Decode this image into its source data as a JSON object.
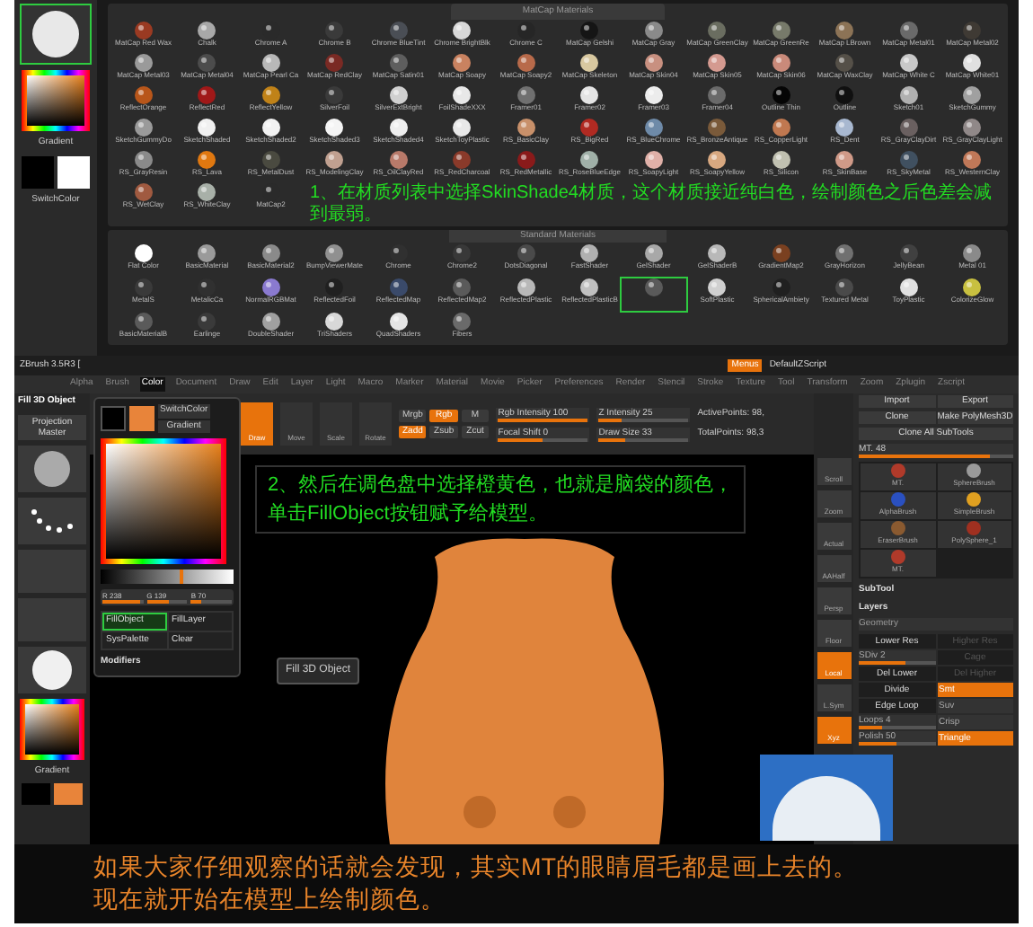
{
  "left_column": {
    "gradient_label": "Gradient",
    "switch_label": "SwitchColor"
  },
  "matcap_panel": {
    "title": "MatCap Materials",
    "materials": [
      {
        "name": "MatCap Red Wax",
        "color": "#9a3a22",
        "selected": false
      },
      {
        "name": "Chalk",
        "color": "#a8a8a8",
        "selected": false
      },
      {
        "name": "Chrome A",
        "color": "#2a2a2a",
        "selected": false
      },
      {
        "name": "Chrome B",
        "color": "#3a3a3a",
        "selected": false
      },
      {
        "name": "Chrome BlueTint",
        "color": "#4a4e55",
        "selected": false
      },
      {
        "name": "Chrome BrightBlk",
        "color": "#d8d8d8",
        "selected": false
      },
      {
        "name": "Chrome C",
        "color": "#262626",
        "selected": false
      },
      {
        "name": "MatCap Gelshi",
        "color": "#151515",
        "selected": false
      },
      {
        "name": "MatCap Gray",
        "color": "#8a8a8a",
        "selected": false
      },
      {
        "name": "MatCap GreenClay",
        "color": "#6a6d60",
        "selected": false
      },
      {
        "name": "MatCap GreenRe",
        "color": "#777a6a",
        "selected": false
      },
      {
        "name": "MatCap LBrown",
        "color": "#8c7356",
        "selected": false
      },
      {
        "name": "MatCap Metal01",
        "color": "#6a6a6a",
        "selected": false
      },
      {
        "name": "MatCap Metal02",
        "color": "#3f3a34",
        "selected": false
      },
      {
        "name": "MatCap Metal03",
        "color": "#9a9a9a",
        "selected": false
      },
      {
        "name": "MatCap Metal04",
        "color": "#4c4c4c",
        "selected": false
      },
      {
        "name": "MatCap Pearl Ca",
        "color": "#b8b8b8",
        "selected": false
      },
      {
        "name": "MatCap RedClay",
        "color": "#7a2a24",
        "selected": false
      },
      {
        "name": "MatCap Satin01",
        "color": "#5e5e5e",
        "selected": false
      },
      {
        "name": "MatCap Soapy",
        "color": "#c98260",
        "selected": false
      },
      {
        "name": "MatCap Soapy2",
        "color": "#b86a4a",
        "selected": false
      },
      {
        "name": "MatCap Skeleton",
        "color": "#d8c8a0",
        "selected": false
      },
      {
        "name": "MatCap Skin04",
        "color": "#c89080",
        "selected": false
      },
      {
        "name": "MatCap Skin05",
        "color": "#d49a90",
        "selected": false
      },
      {
        "name": "MatCap Skin06",
        "color": "#c98a7a",
        "selected": false
      },
      {
        "name": "MatCap WaxClay",
        "color": "#555048",
        "selected": false
      },
      {
        "name": "MatCap White C",
        "color": "#c8c8c8",
        "selected": false
      },
      {
        "name": "MatCap White01",
        "color": "#e0e0e0",
        "selected": false
      },
      {
        "name": "ReflectOrange",
        "color": "#b8561a",
        "selected": false
      },
      {
        "name": "ReflectRed",
        "color": "#a01818",
        "selected": false
      },
      {
        "name": "ReflectYellow",
        "color": "#c08218",
        "selected": false
      },
      {
        "name": "SilverFoil",
        "color": "#3a3a3a",
        "selected": false
      },
      {
        "name": "SilverExtBright",
        "color": "#d0d0d0",
        "selected": false
      },
      {
        "name": "FoilShadeXXX",
        "color": "#e8e8e8",
        "selected": false
      },
      {
        "name": "Framer01",
        "color": "#707070",
        "selected": false
      },
      {
        "name": "Framer02",
        "color": "#e4e4e4",
        "selected": false
      },
      {
        "name": "Framer03",
        "color": "#ececec",
        "selected": false
      },
      {
        "name": "Framer04",
        "color": "#6a6a6a",
        "selected": false
      },
      {
        "name": "Outline Thin",
        "color": "#050505",
        "selected": false
      },
      {
        "name": "Outline",
        "color": "#101010",
        "selected": false
      },
      {
        "name": "Sketch01",
        "color": "#b0b0b0",
        "selected": false
      },
      {
        "name": "SketchGummy",
        "color": "#a0a0a0",
        "selected": false
      },
      {
        "name": "SketchGummyDo",
        "color": "#9a9a9a",
        "selected": false
      },
      {
        "name": "SketchShaded",
        "color": "#f0f0f0",
        "selected": false
      },
      {
        "name": "SketchShaded2",
        "color": "#f2f2f2",
        "selected": false
      },
      {
        "name": "SketchShaded3",
        "color": "#f4f4f4",
        "selected": false
      },
      {
        "name": "SketchShaded4",
        "color": "#eeeeee",
        "selected": false
      },
      {
        "name": "SketchToyPlastic",
        "color": "#e8e8e8",
        "selected": false
      },
      {
        "name": "RS_BasicClay",
        "color": "#c8906a",
        "selected": false
      },
      {
        "name": "RS_BigRed",
        "color": "#b02a22",
        "selected": false
      },
      {
        "name": "RS_BlueChrome",
        "color": "#6e8aa8",
        "selected": false
      },
      {
        "name": "RS_BronzeAntique",
        "color": "#7a5a3a",
        "selected": false
      },
      {
        "name": "RS_CopperLight",
        "color": "#c07850",
        "selected": false
      },
      {
        "name": "RS_Dent",
        "color": "#a8b8d0",
        "selected": false
      },
      {
        "name": "RS_GrayClayDirt",
        "color": "#6a6060",
        "selected": false
      },
      {
        "name": "RS_GrayClayLight",
        "color": "#908888",
        "selected": false
      },
      {
        "name": "RS_GrayResin",
        "color": "#8a8a8a",
        "selected": false
      },
      {
        "name": "RS_Lava",
        "color": "#e07810",
        "selected": false
      },
      {
        "name": "RS_MetalDust",
        "color": "#4a4a40",
        "selected": false
      },
      {
        "name": "RS_ModelingClay",
        "color": "#c0a090",
        "selected": false
      },
      {
        "name": "RS_OilClayRed",
        "color": "#b87a6a",
        "selected": false
      },
      {
        "name": "RS_RedCharcoal",
        "color": "#8a3a2a",
        "selected": false
      },
      {
        "name": "RS_RedMetallic",
        "color": "#8a1a1a",
        "selected": false
      },
      {
        "name": "RS_RoseBlueEdge",
        "color": "#a0b0a8",
        "selected": false
      },
      {
        "name": "RS_SoapyLight",
        "color": "#e0b0a8",
        "selected": false
      },
      {
        "name": "RS_SoapyYellow",
        "color": "#d8a880",
        "selected": false
      },
      {
        "name": "RS_Silicon",
        "color": "#c0c0b0",
        "selected": false
      },
      {
        "name": "RS_SkinBase",
        "color": "#d09a88",
        "selected": false
      },
      {
        "name": "RS_SkyMetal",
        "color": "#405060",
        "selected": false
      },
      {
        "name": "RS_WesternClay",
        "color": "#c07858",
        "selected": false
      },
      {
        "name": "RS_WetClay",
        "color": "#a05a40",
        "selected": false
      },
      {
        "name": "RS_WhiteClay",
        "color": "#a8b0a8",
        "selected": false
      },
      {
        "name": "MatCap2",
        "color": "#2a2a2a",
        "selected": false
      }
    ]
  },
  "annotation_1": "1、在材质列表中选择SkinShade4材质，这个材质接近纯白色，绘制颜色之后色差会减到最弱。",
  "standard_panel": {
    "title": "Standard Materials",
    "materials": [
      {
        "name": "Flat Color",
        "color": "#ffffff",
        "selected": false
      },
      {
        "name": "BasicMaterial",
        "color": "#9a9a9a",
        "selected": false
      },
      {
        "name": "BasicMaterial2",
        "color": "#8a8a8a",
        "selected": false
      },
      {
        "name": "BumpViewerMate",
        "color": "#909090",
        "selected": false
      },
      {
        "name": "Chrome",
        "color": "#303030",
        "selected": false
      },
      {
        "name": "Chrome2",
        "color": "#383838",
        "selected": false
      },
      {
        "name": "DotsDiagonal",
        "color": "#4a4a4a",
        "selected": false
      },
      {
        "name": "FastShader",
        "color": "#b0b0b0",
        "selected": false
      },
      {
        "name": "GelShader",
        "color": "#a8a8a8",
        "selected": false
      },
      {
        "name": "GelShaderB",
        "color": "#b8b8b8",
        "selected": false
      },
      {
        "name": "GradientMap2",
        "color": "#7a4020",
        "selected": false
      },
      {
        "name": "GrayHorizon",
        "color": "#707070",
        "selected": false
      },
      {
        "name": "JellyBean",
        "color": "#404040",
        "selected": false
      },
      {
        "name": "Metal 01",
        "color": "#8a8a8a",
        "selected": false
      },
      {
        "name": "MetalS",
        "color": "#3a3a3a",
        "selected": false
      },
      {
        "name": "MetalicCa",
        "color": "#303030",
        "selected": false
      },
      {
        "name": "NormalRGBMat",
        "color": "#8a7ad0",
        "selected": false
      },
      {
        "name": "ReflectedFoil",
        "color": "#202020",
        "selected": false
      },
      {
        "name": "ReflectedMap",
        "color": "#3a4a6a",
        "selected": false
      },
      {
        "name": "ReflectedMap2",
        "color": "#5a5a5a",
        "selected": false
      },
      {
        "name": "ReflectedPlastic",
        "color": "#b8b8b8",
        "selected": false
      },
      {
        "name": "ReflectedPlasticB",
        "color": "#c0c0c0",
        "selected": false
      },
      {
        "color": "#5a5a5a",
        "selected": true
      },
      {
        "name": "SoftPlastic",
        "color": "#d0d0d0",
        "selected": false
      },
      {
        "name": "SphericalAmbiety",
        "color": "#202020",
        "selected": false
      },
      {
        "name": "Textured Metal",
        "color": "#4a4a4a",
        "selected": false
      },
      {
        "name": "ToyPlastic",
        "color": "#e0e0e0",
        "selected": false
      },
      {
        "name": "ColorizeGlow",
        "color": "#c8c040",
        "selected": false
      },
      {
        "name": "BasicMaterialB",
        "color": "#5a5a5a",
        "selected": false
      },
      {
        "name": "Earlinge",
        "color": "#3a3a3a",
        "selected": false
      },
      {
        "name": "DoubleShader",
        "color": "#a0a0a0",
        "selected": false
      },
      {
        "name": "TriShaders",
        "color": "#d8d8d8",
        "selected": false
      },
      {
        "name": "QuadShaders",
        "color": "#e4e4e4",
        "selected": false
      },
      {
        "name": "Fibers",
        "color": "#6a6a6a",
        "selected": false
      }
    ]
  },
  "zbrush": {
    "title": "ZBrush 3.5R3 [",
    "menus_button": "Menus",
    "script": "DefaultZScript",
    "menu": [
      {
        "label": "Alpha",
        "selected": false
      },
      {
        "label": "Brush",
        "selected": false
      },
      {
        "label": "Color",
        "selected": true
      },
      {
        "label": "Document",
        "selected": false
      },
      {
        "label": "Draw",
        "selected": false
      },
      {
        "label": "Edit",
        "selected": false
      },
      {
        "label": "Layer",
        "selected": false
      },
      {
        "label": "Light",
        "selected": false
      },
      {
        "label": "Macro",
        "selected": false
      },
      {
        "label": "Marker",
        "selected": false
      },
      {
        "label": "Material",
        "selected": false
      },
      {
        "label": "Movie",
        "selected": false
      },
      {
        "label": "Picker",
        "selected": false
      },
      {
        "label": "Preferences",
        "selected": false
      },
      {
        "label": "Render",
        "selected": false
      },
      {
        "label": "Stencil",
        "selected": false
      },
      {
        "label": "Stroke",
        "selected": false
      },
      {
        "label": "Texture",
        "selected": false
      },
      {
        "label": "Tool",
        "selected": false
      },
      {
        "label": "Transform",
        "selected": false
      },
      {
        "label": "Zoom",
        "selected": false
      },
      {
        "label": "Zplugin",
        "selected": false
      },
      {
        "label": "Zscript",
        "selected": false
      }
    ],
    "left_shelf": {
      "fill_label": "Fill 3D Object",
      "projection": "Projection Master",
      "gradient_label": "Gradient"
    },
    "tools": [
      {
        "label": "Draw",
        "on": true
      },
      {
        "label": "Move",
        "on": false
      },
      {
        "label": "Scale",
        "on": false
      },
      {
        "label": "Rotate",
        "on": false
      }
    ],
    "modes": [
      {
        "label": "Mrgb",
        "on": false
      },
      {
        "label": "Rgb",
        "on": true
      },
      {
        "label": "M",
        "on": false
      },
      {
        "label": "Zadd",
        "on": true
      },
      {
        "label": "Zsub",
        "on": false
      },
      {
        "label": "Zcut",
        "on": false
      }
    ],
    "sliders": [
      {
        "label": "Rgb Intensity 100",
        "level": 1
      },
      {
        "label": "Z Intensity 25",
        "level": 0.25
      },
      {
        "label": "Focal Shift 0",
        "level": 0.5
      },
      {
        "label": "Draw Size 33",
        "level": 0.3
      }
    ],
    "stats": [
      "ActivePoints: 98,",
      "TotalPoints: 98,3"
    ],
    "color_popup": {
      "switch_label": "SwitchColor",
      "gradient_label": "Gradient",
      "channels": [
        {
          "label": "R 238",
          "level": 0.93
        },
        {
          "label": "G 139",
          "level": 0.55
        },
        {
          "label": "B 70",
          "level": 0.27
        }
      ],
      "brightness": {
        "level": 0.62
      },
      "buttons": [
        {
          "label": "FillObject",
          "highlighted": true
        },
        {
          "label": "FillLayer",
          "highlighted": false
        },
        {
          "label": "SysPalette",
          "highlighted": false
        },
        {
          "label": "Clear",
          "highlighted": false
        }
      ],
      "modifiers": "Modifiers"
    },
    "tooltip": "Fill 3D Object",
    "annotation_2": [
      "2、然后在调色盘中选择橙黄色，也就是脑袋的颜色，",
      "单击FillObject按钮赋予给模型。"
    ],
    "right_shelf": [
      {
        "label": "Scroll",
        "on": false
      },
      {
        "label": "Zoom",
        "on": false
      },
      {
        "label": "Actual",
        "on": false
      },
      {
        "label": "AAHalf",
        "on": false
      },
      {
        "label": "Persp",
        "on": false
      },
      {
        "label": "Floor",
        "on": false
      },
      {
        "label": "Local",
        "on": true
      },
      {
        "label": "L.Sym",
        "on": false
      },
      {
        "label": "Xyz",
        "on": true
      }
    ],
    "tool_panel": {
      "button_rows": [
        [
          "Import",
          "Export"
        ],
        [
          "Clone",
          "Make PolyMesh3D"
        ],
        [
          "Clone All SubTools"
        ]
      ],
      "tool_slider": {
        "label": "MT. 48",
        "level": 0.85
      },
      "brushes": [
        {
          "name": "MT.",
          "color": "#b03a2a"
        },
        {
          "name": "SphereBrush",
          "color": "#9a9a9a"
        },
        {
          "name": "AlphaBrush",
          "color": "#2a50c0"
        },
        {
          "name": "SimpleBrush",
          "color": "#e0a020"
        },
        {
          "name": "EraserBrush",
          "color": "#8a5a30"
        },
        {
          "name": "PolySphere_1",
          "color": "#a03020"
        },
        {
          "name": "MT.",
          "color": "#b03a2a"
        }
      ],
      "sections": [
        "SubTool",
        "Layers"
      ],
      "geometry_title": "Geometry",
      "geometry": [
        {
          "kind": "button",
          "label": "Lower Res",
          "disabled": false
        },
        {
          "kind": "button",
          "label": "Higher Res",
          "disabled": true
        },
        {
          "kind": "slider",
          "label": "SDiv 2",
          "level": 0.6
        },
        {
          "kind": "button",
          "label": "Cage",
          "disabled": true
        },
        {
          "kind": "button",
          "label": "Del Lower",
          "disabled": false
        },
        {
          "kind": "button",
          "label": "Del Higher",
          "disabled": true
        },
        {
          "kind": "button",
          "label": "Divide",
          "disabled": false
        },
        {
          "kind": "toggle",
          "label": "Smt",
          "on": true
        },
        {
          "kind": "button",
          "label": "Edge Loop",
          "disabled": false
        },
        {
          "kind": "toggle",
          "label": "Suv",
          "on": false
        },
        {
          "kind": "slider",
          "label": "Loops 4",
          "level": 0.3
        },
        {
          "kind": "toggle",
          "label": "Crisp",
          "on": false
        },
        {
          "kind": "slider",
          "label": "Polish 50",
          "level": 0.5
        },
        {
          "kind": "toggle",
          "label": "Triangle",
          "on": true
        }
      ]
    }
  },
  "caption": [
    "如果大家仔细观察的话就会发现，其实MT的眼睛眉毛都是画上去的。",
    "现在就开始在模型上绘制颜色。"
  ]
}
